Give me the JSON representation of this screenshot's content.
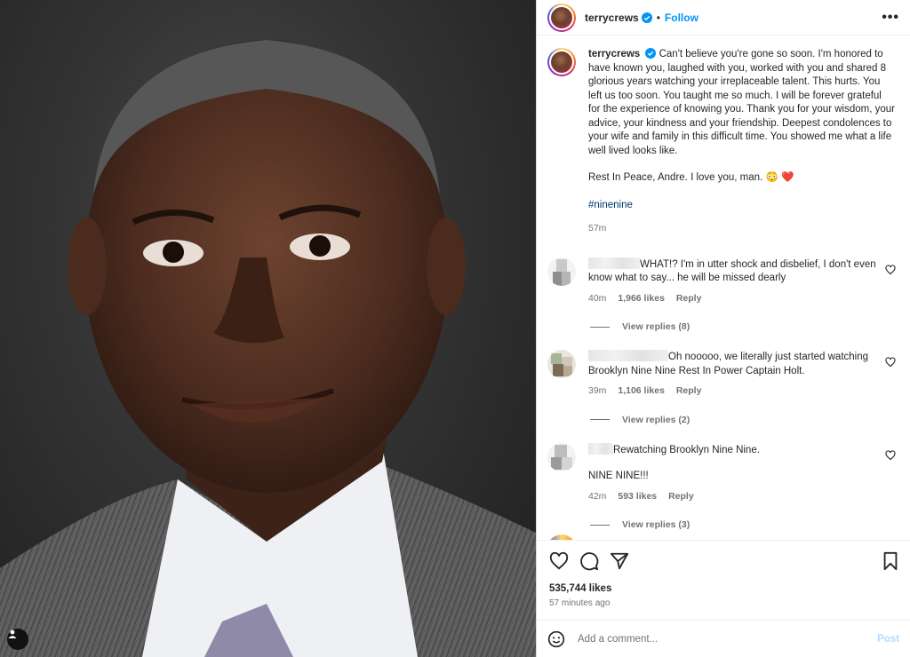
{
  "post": {
    "username": "terrycrews",
    "follow_label": "Follow",
    "dot": "•",
    "more_label": "•••",
    "caption_lines": [
      "Can't believe you're gone so soon. I'm honored to have known you, laughed with you, worked with you and shared 8 glorious years watching your irreplaceable talent. This hurts. You left us too soon. You taught me so much. I will be forever grateful for the experience of knowing you. Thank you for your wisdom, your advice, your kindness and your friendship. Deepest condolences to your wife and family in this difficult time. You showed me what a life well lived looks like.",
      "Rest In Peace, Andre. I love you, man. 😳 ❤️"
    ],
    "hashtag": "#ninenine",
    "caption_time": "57m"
  },
  "comments": [
    {
      "text": "WHAT!? I'm in utter shock and disbelief, I don't even know what to say... he will be missed dearly",
      "time": "40m",
      "likes": "1,966 likes",
      "reply_label": "Reply",
      "view_replies": "View replies (8)"
    },
    {
      "text": "Oh nooooo, we literally just started watching Brooklyn Nine Nine Rest In Power Captain Holt.",
      "time": "39m",
      "likes": "1,106 likes",
      "reply_label": "Reply",
      "view_replies": "View replies (2)"
    },
    {
      "text": "Rewatching Brooklyn Nine Nine.",
      "text2": "NINE NINE!!!",
      "time": "42m",
      "likes": "593 likes",
      "reply_label": "Reply",
      "view_replies": "View replies (3)"
    }
  ],
  "actions": {
    "likes": "535,744 likes",
    "ago": "57 minutes ago"
  },
  "composer": {
    "placeholder": "Add a comment...",
    "post_label": "Post"
  },
  "colors": {
    "accent": "#0095f6",
    "hashtag": "#00376b",
    "muted": "#737373",
    "post_disabled": "#b3dbff"
  }
}
